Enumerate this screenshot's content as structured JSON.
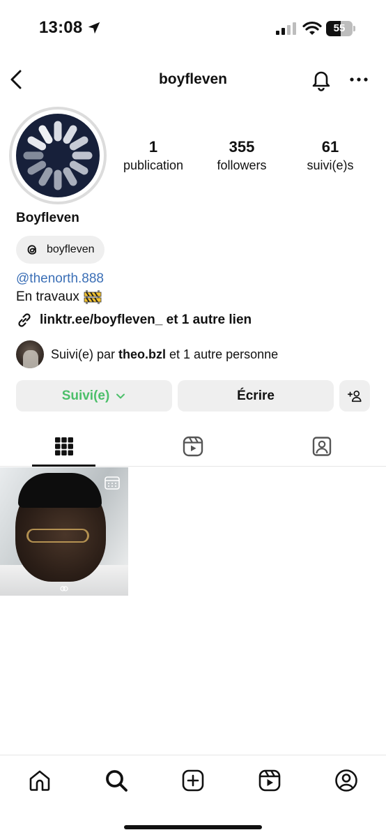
{
  "status_bar": {
    "time": "13:08",
    "battery_level": "55",
    "battery_fraction": 0.55
  },
  "header": {
    "username": "boyfleven"
  },
  "profile": {
    "stats": [
      {
        "value": "1",
        "label": "publication"
      },
      {
        "value": "355",
        "label": "followers"
      },
      {
        "value": "61",
        "label": "suivi(e)s"
      }
    ],
    "display_name": "Boyfleven",
    "threads_handle": "boyfleven",
    "mention": "@thenorth.888",
    "bio": "En travaux",
    "link": "linktr.ee/boyfleven_ et 1 autre lien",
    "followed_by": {
      "prefix": "Suivi(e) par ",
      "user": "theo.bzl",
      "suffix": " et 1 autre personne"
    }
  },
  "actions": {
    "follow_label": "Suivi(e)",
    "message_label": "Écrire"
  },
  "colors": {
    "follow_green": "#4cbf6a",
    "mention_blue": "#3b6fb6",
    "button_bg": "#efefef",
    "avatar_bg": "#17203a"
  },
  "icons": {
    "tabs": [
      "grid-icon",
      "reels-icon",
      "tagged-icon"
    ],
    "bottom_nav": [
      "home-icon",
      "search-icon",
      "create-icon",
      "reels-icon",
      "profile-icon"
    ]
  }
}
